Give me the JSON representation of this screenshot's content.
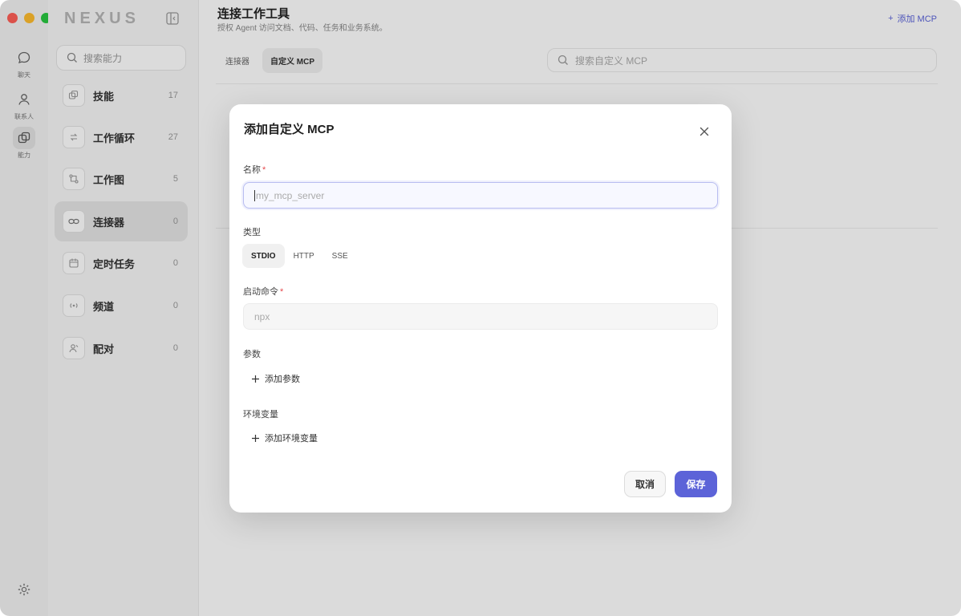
{
  "window": {
    "controls": [
      "close",
      "minimize",
      "zoom"
    ]
  },
  "rail": {
    "items": [
      {
        "label": "聊天",
        "icon": "chat-bubble-icon"
      },
      {
        "label": "联系人",
        "icon": "contacts-icon"
      },
      {
        "label": "能力",
        "icon": "capabilities-icon",
        "active": true
      }
    ],
    "bottom": [
      "settings-icon",
      "compass-icon"
    ]
  },
  "sidebar": {
    "brand": "NEXUS",
    "search_placeholder": "搜索能力",
    "items": [
      {
        "label": "技能",
        "count": "17",
        "icon": "skill-icon"
      },
      {
        "label": "工作循环",
        "count": "27",
        "icon": "loop-icon"
      },
      {
        "label": "工作图",
        "count": "5",
        "icon": "graph-icon"
      },
      {
        "label": "连接器",
        "count": "0",
        "icon": "link-icon",
        "active": true
      },
      {
        "label": "定时任务",
        "count": "0",
        "icon": "calendar-icon"
      },
      {
        "label": "频道",
        "count": "0",
        "icon": "broadcast-icon"
      },
      {
        "label": "配对",
        "count": "0",
        "icon": "pair-icon"
      }
    ]
  },
  "main": {
    "title": "连接工作工具",
    "subtitle": "授权 Agent 访问文档、代码、任务和业务系统。",
    "add_button": "添加 MCP",
    "tabs": [
      {
        "label": "连接器"
      },
      {
        "label": "自定义 MCP",
        "active": true
      }
    ],
    "search_placeholder": "搜索自定义 MCP"
  },
  "modal": {
    "title": "添加自定义 MCP",
    "name_label": "名称",
    "name_required": "*",
    "name_placeholder": "my_mcp_server",
    "type_label": "类型",
    "types": [
      {
        "label": "STDIO",
        "active": true
      },
      {
        "label": "HTTP"
      },
      {
        "label": "SSE"
      }
    ],
    "command_label": "启动命令",
    "command_required": "*",
    "command_placeholder": "npx",
    "args_label": "参数",
    "add_arg": "添加参数",
    "env_label": "环境变量",
    "add_env": "添加环境变量",
    "cancel": "取消",
    "save": "保存"
  },
  "colors": {
    "accent": "#5c63d8",
    "required": "#e5484d",
    "focus_border": "#b8bdf0"
  }
}
